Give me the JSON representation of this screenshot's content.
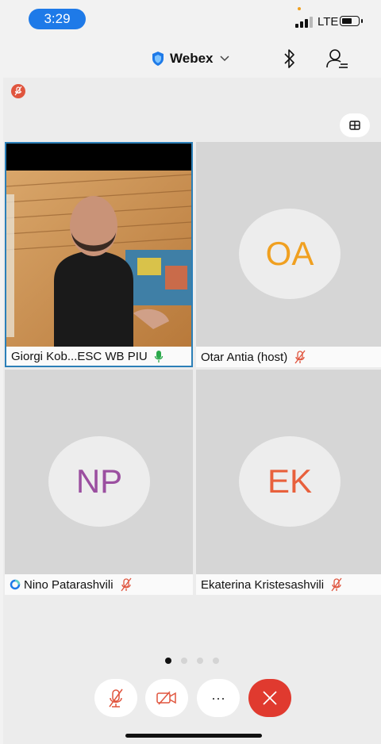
{
  "status_bar": {
    "time": "3:29",
    "carrier": "LTE"
  },
  "header": {
    "app_title": "Webex",
    "icons": [
      "shield-icon",
      "chevron-down-icon",
      "bluetooth-icon",
      "participants-icon"
    ]
  },
  "layout_button_icon": "grid-layout-icon",
  "participants": [
    {
      "name": "Giorgi Kob...ESC WB PIU",
      "initials": "",
      "video": true,
      "mic": "on",
      "mic_color": "#2aa84a"
    },
    {
      "name": "Otar Antia (host)",
      "initials": "OA",
      "video": false,
      "mic": "muted",
      "avatar_color": "#f0a020"
    },
    {
      "name": "Nino Patarashvili",
      "initials": "NP",
      "video": false,
      "mic": "muted",
      "avatar_color": "#9b4fa0",
      "status_icon": "spinner-icon"
    },
    {
      "name": "Ekaterina Kristesashvili",
      "initials": "EK",
      "video": false,
      "mic": "muted",
      "avatar_color": "#e8603c"
    }
  ],
  "pagination": {
    "pages": 4,
    "current": 1
  },
  "controls": {
    "buttons": [
      "mute-button",
      "video-button",
      "more-button",
      "end-call-button"
    ],
    "more_label": "···",
    "end_color": "#e03a2f",
    "muted_color": "#e0553e"
  }
}
